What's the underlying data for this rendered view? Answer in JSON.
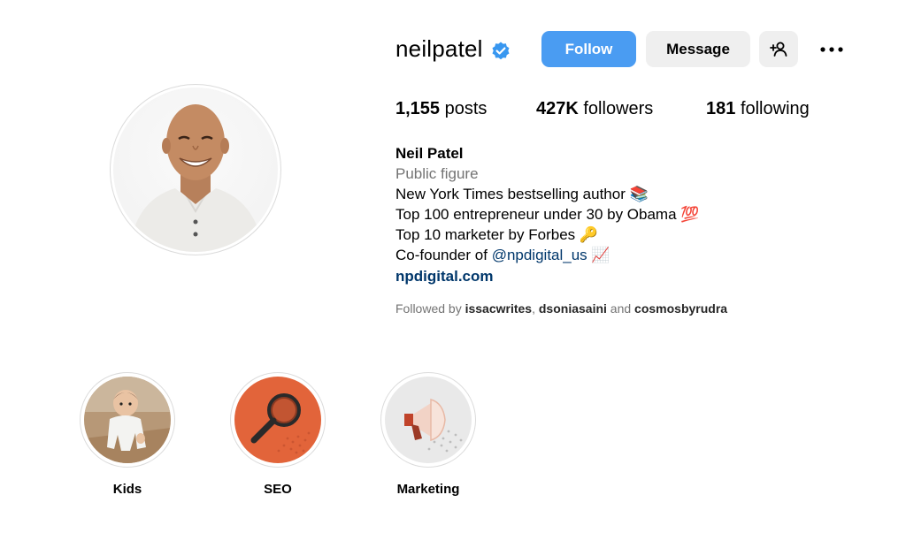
{
  "profile": {
    "username": "neilpatel",
    "verified": true,
    "buttons": {
      "follow": "Follow",
      "message": "Message"
    },
    "stats": {
      "posts_value": "1,155",
      "posts_label": "posts",
      "followers_value": "427K",
      "followers_label": "followers",
      "following_value": "181",
      "following_label": "following"
    },
    "bio": {
      "name": "Neil Patel",
      "category": "Public figure",
      "line1": "New York Times bestselling author 📚",
      "line2": "Top 100 entrepreneur under 30 by Obama 💯",
      "line3": "Top 10 marketer by Forbes 🔑",
      "line4_prefix": "Co-founder of ",
      "line4_mention": "@npdigital_us",
      "line4_suffix": " 📈",
      "link": "npdigital.com"
    },
    "followed_by": {
      "prefix": "Followed by ",
      "user1": "issacwrites",
      "sep": ", ",
      "user2": "dsoniasaini",
      "and": " and ",
      "user3": "cosmosbyrudra"
    }
  },
  "highlights": [
    {
      "label": "Kids",
      "icon": "child-photo"
    },
    {
      "label": "SEO",
      "icon": "magnifier-icon",
      "color": "#e2643a"
    },
    {
      "label": "Marketing",
      "icon": "megaphone-icon",
      "color": "#e9e9e9"
    }
  ],
  "colors": {
    "accent": "#4a9cf2",
    "link": "#00376b",
    "muted": "#737373"
  }
}
